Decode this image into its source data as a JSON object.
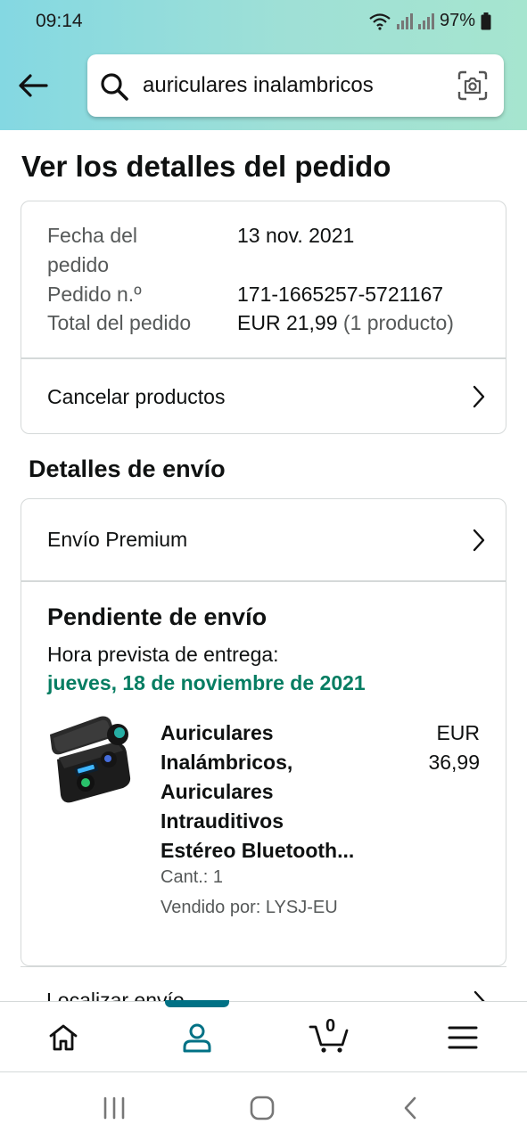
{
  "status_bar": {
    "time": "09:14",
    "battery": "97%"
  },
  "search": {
    "query": "auriculares inalambricos"
  },
  "page": {
    "title": "Ver los detalles del pedido"
  },
  "order_summary": {
    "date_label_line1": "Fecha del",
    "date_label_line2": "pedido",
    "date_value": "13 nov. 2021",
    "number_label": "Pedido n.º",
    "number_value": "171-1665257-5721167",
    "total_label": "Total del pedido",
    "total_value": "EUR 21,99",
    "total_count": "(1 producto)",
    "cancel_label": "Cancelar productos"
  },
  "shipping": {
    "section_title": "Detalles de envío",
    "premium_label": "Envío Premium",
    "status_title": "Pendiente de envío",
    "eta_label": "Hora prevista de entrega:",
    "eta_date": "jueves, 18 de noviembre de 2021",
    "track_label": "Localizar envío"
  },
  "product": {
    "name_lines": [
      "Auriculares",
      "Inalámbricos,",
      "Auriculares",
      "Intrauditivos",
      "Estéreo Bluetooth..."
    ],
    "price_line1": "EUR",
    "price_line2": "36,99",
    "qty": "Cant.: 1",
    "seller": "Vendido por: LYSJ-EU",
    "image_icon": "earbuds-case-icon"
  },
  "bottom_nav": {
    "items": [
      "home-icon",
      "account-icon",
      "cart-icon",
      "menu-icon"
    ],
    "active": "account-icon",
    "cart_count": "0"
  },
  "system_nav": [
    "recents-icon",
    "home-circle-icon",
    "back-chevron-icon"
  ],
  "colors": {
    "accent": "#007185",
    "delivery_green": "#067d62",
    "header_start": "#84d8e2",
    "header_end": "#a6e5cf"
  }
}
